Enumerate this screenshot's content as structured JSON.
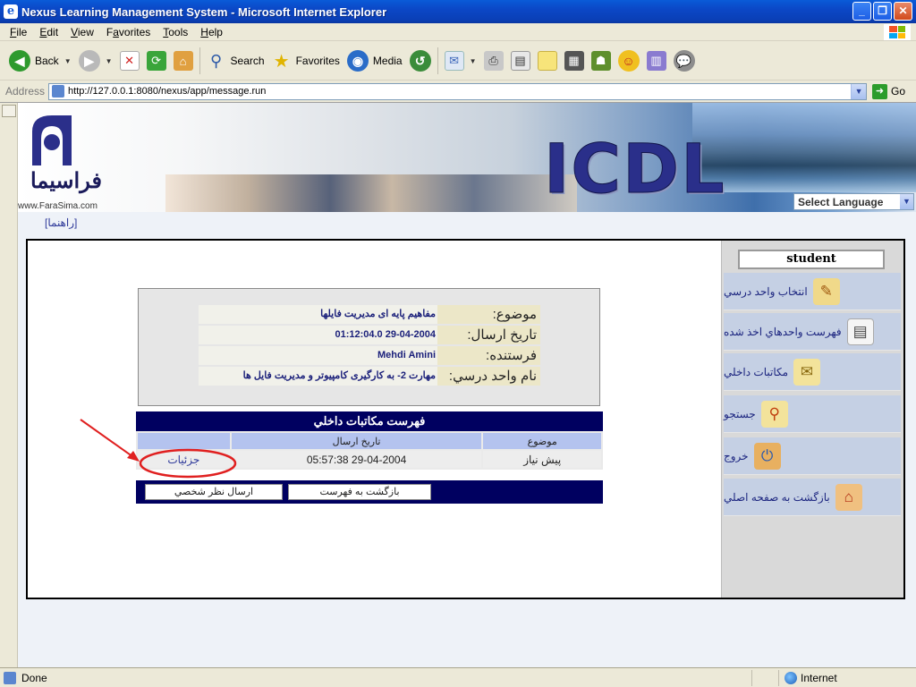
{
  "window": {
    "title": "Nexus Learning Management System - Microsoft Internet Explorer",
    "controls": [
      "minimize",
      "restore",
      "close"
    ]
  },
  "menu": {
    "items": [
      {
        "label": "File",
        "key": "F",
        "rest": "ile"
      },
      {
        "label": "Edit",
        "key": "E",
        "rest": "dit"
      },
      {
        "label": "View",
        "key": "V",
        "rest": "iew"
      },
      {
        "label": "Favorites",
        "key": "a",
        "pre": "F",
        "rest": "vorites"
      },
      {
        "label": "Tools",
        "key": "T",
        "rest": "ools"
      },
      {
        "label": "Help",
        "key": "H",
        "rest": "elp"
      }
    ]
  },
  "toolbar": {
    "back": "Back",
    "search": "Search",
    "favorites": "Favorites",
    "media": "Media"
  },
  "address": {
    "label": "Address",
    "url": "http://127.0.0.1:8080/nexus/app/message.run",
    "go": "Go"
  },
  "banner": {
    "logo_text": "فراسيما",
    "logo_url": "www.FaraSima.com",
    "brand": "ICDL",
    "language_select": "Select Language"
  },
  "help_link": "[راهنما]",
  "sidebar": {
    "user": "student",
    "items": [
      {
        "label": "انتخاب واحد درسي",
        "icon": "pencil-icon"
      },
      {
        "label": "فهرست واحدهاي اخذ شده",
        "icon": "document-icon"
      },
      {
        "label": "مكاتبات داخلي",
        "icon": "envelope-icon"
      },
      {
        "label": "جستجو",
        "icon": "magnifier-icon"
      },
      {
        "label": "خروج",
        "icon": "exit-icon"
      },
      {
        "label": "بازگشت به صفحه اصلي",
        "icon": "home-icon"
      }
    ]
  },
  "message": {
    "subject_label": "موضوع:",
    "subject": "مفاهيم پايه ای مديريت فايلها",
    "date_label": "تاريخ ارسال:",
    "date": "01:12:04.0 29-04-2004",
    "sender_label": "فرستنده:",
    "sender": "Mehdi Amini",
    "course_label": "نام واحد درسي:",
    "course": "مهارت 2- به کارگيری کامپيوتر و مديريت فايل ها"
  },
  "list": {
    "title": "فهرست مكاتبات داخلي",
    "columns": [
      "",
      "تاريخ ارسال",
      "موضوع"
    ],
    "rows": [
      {
        "details": "جزئيات",
        "date": "05:57:38 29-04-2004",
        "subject": "پيش نياز"
      }
    ]
  },
  "buttons": {
    "send_comment": "ارسال نظر شخصي",
    "back_to_list": "بازگشت به فهرست"
  },
  "status": {
    "text": "Done",
    "zone": "Internet"
  },
  "colors": {
    "titlebar": "#0b47c6",
    "nav_dark": "#000060",
    "sidebar_item": "#c5d0e4",
    "annotation": "#e02020"
  }
}
